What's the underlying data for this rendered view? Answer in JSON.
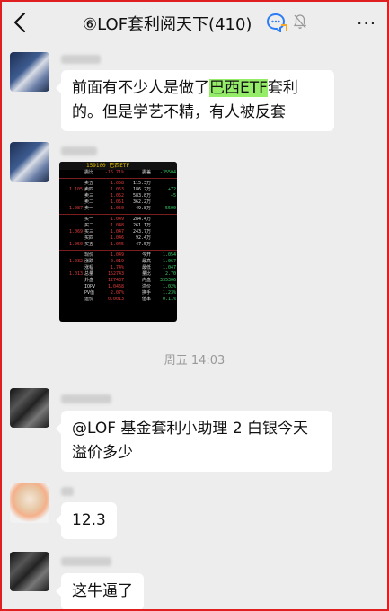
{
  "header": {
    "title": "⑥LOF套利阅天下(410)",
    "back_icon": "chevron-left-icon",
    "group_icon": "qq-group-icon",
    "mute_icon": "bell-muted-icon",
    "more_label": "···"
  },
  "messages": [
    {
      "text_before": "前面有不少人是做了",
      "highlight": "巴西ETF",
      "text_after": "套利的。但是学艺不精，有人被反套"
    },
    {
      "image": {
        "title": "159100 巴西ETF",
        "rows": [
          [
            "",
            "委比",
            "-16.71%",
            "委差",
            "-35504"
          ],
          [
            "",
            "卖五",
            "1.058",
            "115.3万",
            ""
          ],
          [
            "1.105",
            "卖四",
            "1.053",
            "186.2万",
            "+72"
          ],
          [
            "",
            "卖三",
            "1.052",
            "583.8万",
            "+5"
          ],
          [
            "",
            "卖二",
            "1.051",
            "362.2万",
            ""
          ],
          [
            "1.087",
            "卖一",
            "1.050",
            "49.8万",
            "-5500"
          ],
          [
            "",
            "买一",
            "1.049",
            "284.4万",
            ""
          ],
          [
            "",
            "买二",
            "1.048",
            "261.1万",
            ""
          ],
          [
            "1.069",
            "买三",
            "1.047",
            "243.7万",
            ""
          ],
          [
            "",
            "买四",
            "1.046",
            "92.4万",
            ""
          ],
          [
            "1.050",
            "买五",
            "1.045",
            "47.5万",
            ""
          ],
          [
            "",
            "现价",
            "1.049",
            "今开",
            "1.054"
          ],
          [
            "1.032",
            "涨跌",
            "0.019",
            "最高",
            "1.067"
          ],
          [
            "",
            "涨幅",
            "1.74%",
            "最低",
            "1.047"
          ],
          [
            "1.013",
            "总量",
            "152743",
            "量比",
            "2.70"
          ],
          [
            "",
            "外盘",
            "127437",
            "内盘",
            "335306"
          ],
          [
            "",
            "IOPV",
            "1.0468",
            "溢价",
            "1.02%"
          ],
          [
            "",
            "PV值",
            "2.07%",
            "换手",
            "1.23%"
          ],
          [
            "",
            "运价",
            "0.0013",
            "值率",
            "0.11%"
          ]
        ]
      }
    },
    {
      "timestamp": "周五 14:03"
    },
    {
      "text": "@LOF 基金套利小助理 2  白银今天溢价多少"
    },
    {
      "text": "12.3"
    },
    {
      "text": "这牛逼了"
    }
  ],
  "colors": {
    "background": "#ededed",
    "bubble": "#ffffff",
    "highlight": "#95ec69",
    "frame": "#e02020"
  }
}
